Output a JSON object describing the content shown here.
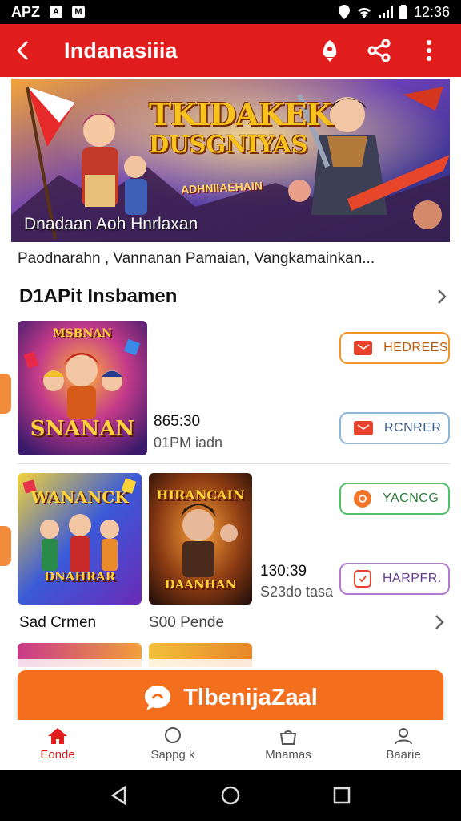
{
  "status_bar": {
    "left_text": "APZ",
    "box1": "A",
    "box2": "M",
    "time": "12:36"
  },
  "app_bar": {
    "title": "Indanasiiia"
  },
  "hero": {
    "title_line1": "TKIDAKEK",
    "title_line2": "DUSGNIYAS",
    "subtitle": "ADHNIIAEHAIN",
    "caption": "Dnadaan Aoh Hnrlaxan"
  },
  "description": "Paodnarahn , Vannanan Pamaian, Vangkamainkan...",
  "section": {
    "title": "D1APit Insbamen"
  },
  "items": [
    {
      "thumb_label_top": "MSBNAN",
      "thumb_label": "SNANAN",
      "price": "865:30",
      "sub": "01PM iadn"
    },
    {
      "thumb_label_top": "WANANCK",
      "thumb_label": "DNAHRAR",
      "price": "",
      "sub": ""
    },
    {
      "thumb_label_top": "HIRANCAIN",
      "thumb_label": "DAANHAN",
      "price": "130:39",
      "sub": "S23do tasa"
    }
  ],
  "chips": [
    {
      "label": "HEDREES",
      "color": "#f0962a",
      "icon_color": "#e8422a"
    },
    {
      "label": "RCNRER",
      "color": "#8db5d8",
      "icon_color": "#e8422a"
    },
    {
      "label": "YACNCG",
      "color": "#4fc26a",
      "icon_color": "#e8422a"
    },
    {
      "label": "HARPFR.",
      "color": "#b27ad0",
      "icon_color": "#e8422a"
    }
  ],
  "row_labels": {
    "left": "Sad Crmen",
    "right": "S00 Pende"
  },
  "cta": {
    "label": "TlbenijaZaal"
  },
  "bottom_nav": [
    {
      "label": "Eonde",
      "icon": "home-icon",
      "active": true
    },
    {
      "label": "Sappg k",
      "icon": "chat-icon",
      "active": false
    },
    {
      "label": "Mnamas",
      "icon": "bag-icon",
      "active": false
    },
    {
      "label": "Baarie",
      "icon": "person-icon",
      "active": false
    }
  ],
  "colors": {
    "primary": "#e11d1d",
    "cta": "#f46f1d"
  }
}
